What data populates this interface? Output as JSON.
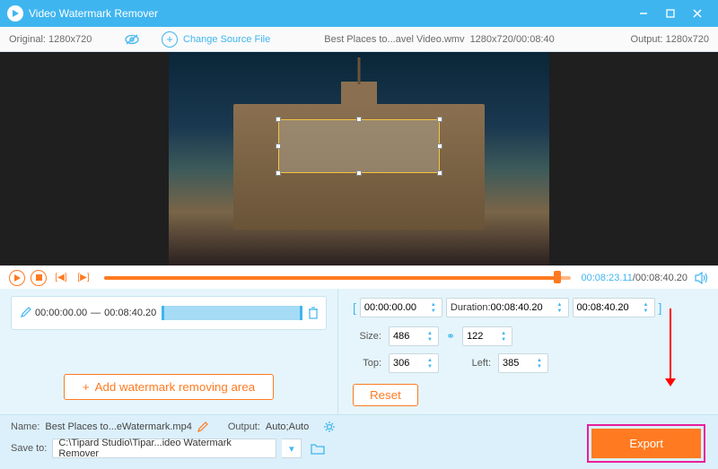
{
  "titlebar": {
    "title": "Video Watermark Remover"
  },
  "subbar": {
    "original_label": "Original:",
    "original_res": "1280x720",
    "change_label": "Change Source File",
    "filename": "Best Places to...avel Video.wmv",
    "source_dim": "1280x720/00:08:40",
    "output_label": "Output:",
    "output_res": "1280x720"
  },
  "playbar": {
    "current": "00:08:23.11",
    "duration": "00:08:40.20"
  },
  "clip": {
    "start": "00:00:00.00",
    "sep": "—",
    "end": "00:08:40.20"
  },
  "addbtn": {
    "label": "Add watermark removing area"
  },
  "timebox": {
    "start": "00:00:00.00",
    "duration_label": "Duration:",
    "duration": "00:08:40.20",
    "end": "00:08:40.20"
  },
  "size": {
    "label": "Size:",
    "w": "486",
    "h": "122"
  },
  "pos": {
    "top_label": "Top:",
    "top": "306",
    "left_label": "Left:",
    "left": "385"
  },
  "reset": "Reset",
  "bottom": {
    "name_label": "Name:",
    "name": "Best Places to...eWatermark.mp4",
    "output_label": "Output:",
    "output": "Auto;Auto",
    "save_label": "Save to:",
    "save_path": "C:\\Tipard Studio\\Tipar...ideo Watermark Remover"
  },
  "export": "Export"
}
